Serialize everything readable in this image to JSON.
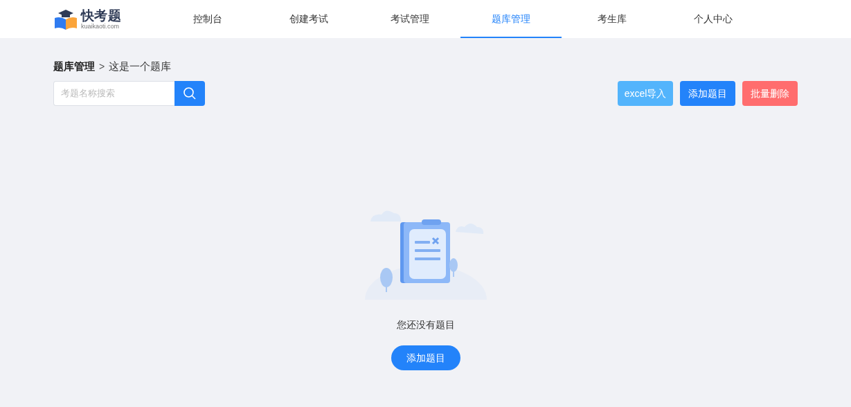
{
  "logo": {
    "name": "快考题",
    "domain": "kuaikaoti.com"
  },
  "nav": [
    {
      "label": "控制台",
      "selected": false
    },
    {
      "label": "创建考试",
      "selected": false
    },
    {
      "label": "考试管理",
      "selected": false
    },
    {
      "label": "题库管理",
      "selected": true
    },
    {
      "label": "考生库",
      "selected": false
    },
    {
      "label": "个人中心",
      "selected": false
    }
  ],
  "breadcrumb": {
    "parent": "题库管理",
    "separator": ">",
    "current": "这是一个题库"
  },
  "search": {
    "placeholder": "考题名称搜索"
  },
  "actions": [
    {
      "label": "excel导入",
      "kind": "info"
    },
    {
      "label": "添加题目",
      "kind": "primary"
    },
    {
      "label": "批量删除",
      "kind": "danger"
    }
  ],
  "empty_state": {
    "message": "您还没有题目",
    "button": "添加题目"
  }
}
